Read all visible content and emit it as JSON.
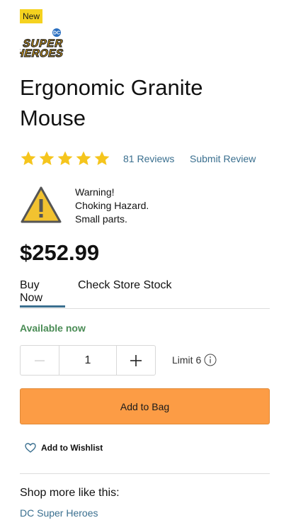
{
  "badge": {
    "label": "New"
  },
  "brand": {
    "logo_top": "DC",
    "logo_line1": "SUPER",
    "logo_line2": "HEROES"
  },
  "product": {
    "title": "Ergonomic Granite Mouse",
    "price": "$252.99"
  },
  "rating": {
    "stars": 5,
    "max": 5,
    "reviews_label": "81 Reviews",
    "submit_label": "Submit Review"
  },
  "warning": {
    "line1": "Warning!",
    "line2": "Choking Hazard.",
    "line3": "Small parts."
  },
  "tabs": [
    {
      "label": "Buy Now",
      "active": true
    },
    {
      "label": "Check Store Stock",
      "active": false
    }
  ],
  "availability": "Available now",
  "quantity": {
    "value": "1",
    "limit_label": "Limit 6"
  },
  "add_to_bag_label": "Add to Bag",
  "wishlist_label": "Add to Wishlist",
  "shop_more": {
    "heading": "Shop more like this:",
    "link": "DC Super Heroes"
  },
  "colors": {
    "star": "#f5c51d",
    "link": "#3a6f8f",
    "available": "#4a8c55",
    "add_button": "#fc9c45",
    "badge": "#f5d21f"
  }
}
